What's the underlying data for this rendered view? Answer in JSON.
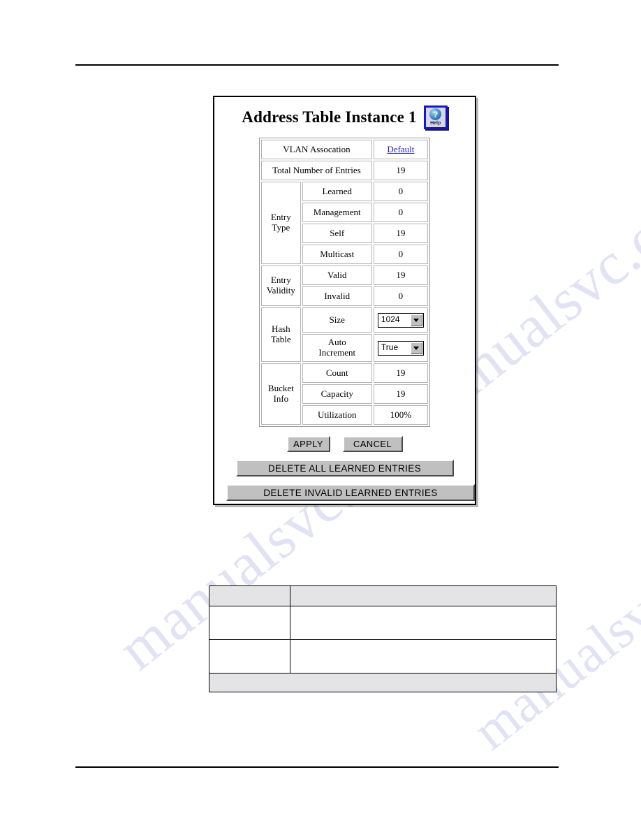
{
  "document": {
    "rules": {
      "top": "horizontal-rule",
      "bottom": "horizontal-rule"
    },
    "watermark_text": "manualsvc.com"
  },
  "panel": {
    "title": "Address Table Instance 1",
    "help_button": {
      "glyph": "?",
      "label": "Help"
    }
  },
  "table": {
    "rows": [
      {
        "group": "",
        "label": "VLAN Assocation",
        "value": "Default",
        "value_kind": "link"
      },
      {
        "group": "",
        "label": "Total Number of Entries",
        "value": "19",
        "value_kind": "text"
      },
      {
        "group": "Entry Type",
        "label": "Learned",
        "value": "0",
        "value_kind": "text"
      },
      {
        "group": "",
        "label": "Management",
        "value": "0",
        "value_kind": "text"
      },
      {
        "group": "",
        "label": "Self",
        "value": "19",
        "value_kind": "text"
      },
      {
        "group": "",
        "label": "Multicast",
        "value": "0",
        "value_kind": "text"
      },
      {
        "group": "Entry Validity",
        "label": "Valid",
        "value": "19",
        "value_kind": "text"
      },
      {
        "group": "",
        "label": "Invalid",
        "value": "0",
        "value_kind": "text"
      },
      {
        "group": "Hash Table",
        "label": "Size",
        "value": "1024",
        "value_kind": "select"
      },
      {
        "group": "",
        "label": "Auto Increment",
        "value": "True",
        "value_kind": "select"
      },
      {
        "group": "Bucket Info",
        "label": "Count",
        "value": "19",
        "value_kind": "text"
      },
      {
        "group": "",
        "label": "Capacity",
        "value": "19",
        "value_kind": "text"
      },
      {
        "group": "",
        "label": "Utilization",
        "value": "100%",
        "value_kind": "text"
      }
    ],
    "groups": {
      "entry_type": "Entry Type",
      "entry_type_line1": "Entry",
      "entry_type_line2": "Type",
      "entry_validity_line1": "Entry",
      "entry_validity_line2": "Validity",
      "hash_table_line1": "Hash",
      "hash_table_line2": "Table",
      "bucket_info_line1": "Bucket",
      "bucket_info_line2": "Info"
    },
    "labels": {
      "vlan_assocation": "VLAN Assocation",
      "total_number_of_entries": "Total Number of Entries",
      "learned": "Learned",
      "management": "Management",
      "self": "Self",
      "multicast": "Multicast",
      "valid": "Valid",
      "invalid": "Invalid",
      "size": "Size",
      "auto_increment_line1": "Auto",
      "auto_increment_line2": "Increment",
      "count": "Count",
      "capacity": "Capacity",
      "utilization": "Utilization"
    },
    "values": {
      "vlan_assocation": "Default",
      "total_number_of_entries": "19",
      "learned": "0",
      "management": "0",
      "self": "19",
      "multicast": "0",
      "valid": "19",
      "invalid": "0",
      "hash_size": "1024",
      "auto_increment": "True",
      "bucket_count": "19",
      "bucket_capacity": "19",
      "bucket_utilization": "100%"
    }
  },
  "buttons": {
    "apply": "APPLY",
    "cancel": "CANCEL",
    "delete_all_learned": "DELETE ALL LEARNED ENTRIES",
    "delete_invalid_learned": "DELETE INVALID LEARNED ENTRIES"
  },
  "reference_table": {
    "header": [
      "",
      ""
    ],
    "rows": [
      [
        "",
        ""
      ],
      [
        "",
        ""
      ]
    ],
    "footer": ""
  },
  "colors": {
    "link": "#2020dd",
    "help_border": "#1414dc",
    "button_face": "#c0c0c0",
    "table_header_fill": "#e4e4e6",
    "watermark": "#c9cdee"
  }
}
